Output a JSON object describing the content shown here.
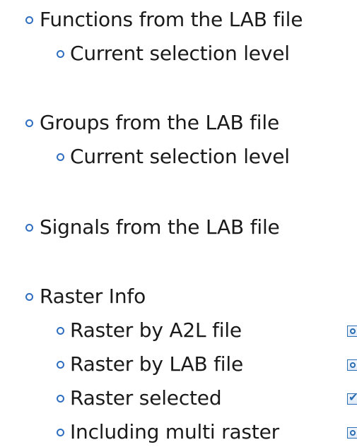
{
  "items": [
    {
      "text": "Functions from the LAB file",
      "sub": [
        "Current selection level"
      ]
    },
    {
      "text": "Groups from the LAB file",
      "sub": [
        "Current selection level"
      ]
    },
    {
      "text": "Signals from the LAB file",
      "sub": []
    },
    {
      "text": "Raster Info",
      "sub": [
        "Raster by A2L file",
        "Raster by LAB file",
        "Raster selected",
        "Including multi raster"
      ]
    }
  ],
  "raster_controls": [
    {
      "kind": "radio",
      "checked": true
    },
    {
      "kind": "radio",
      "checked": false
    },
    {
      "kind": "checkbox",
      "checked": true
    },
    {
      "kind": "radio",
      "checked": false
    }
  ],
  "colors": {
    "bullet": "#2f6ec0",
    "control": "#2a6db3"
  }
}
